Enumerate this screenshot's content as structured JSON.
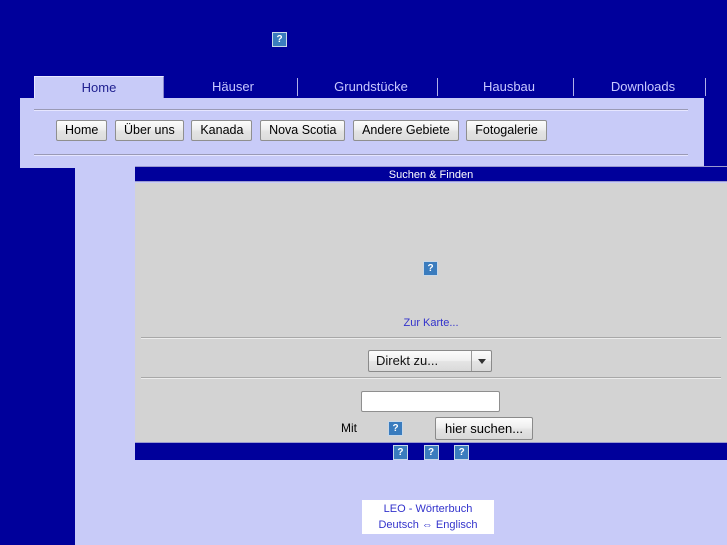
{
  "page": {
    "background_color": "#00009b",
    "panel_color": "#c8cbf8",
    "widget_body_color": "#d3d3d3",
    "link_color": "#3333cc"
  },
  "logo": {
    "icon": "broken-image-icon",
    "glyph": "?"
  },
  "tabs": [
    {
      "label": "Home",
      "active": true
    },
    {
      "label": "Häuser",
      "active": false
    },
    {
      "label": "Grundstücke",
      "active": false
    },
    {
      "label": "Hausbau",
      "active": false
    },
    {
      "label": "Downloads",
      "active": false
    }
  ],
  "nav_buttons": [
    {
      "label": "Home"
    },
    {
      "label": "Über uns"
    },
    {
      "label": "Kanada"
    },
    {
      "label": "Nova Scotia"
    },
    {
      "label": "Andere Gebiete"
    },
    {
      "label": "Fotogalerie"
    }
  ],
  "search_widget": {
    "title": "Suchen & Finden",
    "map_image": {
      "icon": "broken-image-icon",
      "glyph": "?"
    },
    "map_link": "Zur Karte...",
    "direkt_select": {
      "selected": "Direkt zu...",
      "arrow_icon": "chevron-down-icon"
    },
    "query_input": {
      "value": "",
      "placeholder": ""
    },
    "with_label": "Mit",
    "with_icon": {
      "icon": "broken-image-icon",
      "glyph": "?"
    },
    "search_button": "hier suchen...",
    "footer_icons": [
      {
        "icon": "broken-image-icon",
        "glyph": "?"
      },
      {
        "icon": "broken-image-icon",
        "glyph": "?"
      },
      {
        "icon": "broken-image-icon",
        "glyph": "?"
      }
    ]
  },
  "leo_box": {
    "line1": "LEO - Wörterbuch",
    "line2": "Deutsch ⇔ Englisch"
  }
}
